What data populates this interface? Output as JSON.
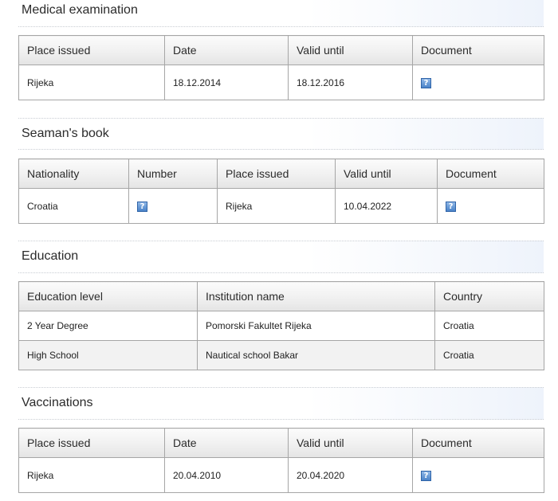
{
  "medical": {
    "title": "Medical examination",
    "headers": [
      "Place issued",
      "Date",
      "Valid until",
      "Document"
    ],
    "rows": [
      {
        "place": "Rijeka",
        "date": "18.12.2014",
        "valid": "18.12.2016",
        "doc_icon": "?"
      }
    ]
  },
  "seamans_book": {
    "title": "Seaman's book",
    "headers": [
      "Nationality",
      "Number",
      "Place issued",
      "Valid until",
      "Document"
    ],
    "rows": [
      {
        "nationality": "Croatia",
        "number_icon": "?",
        "place": "Rijeka",
        "valid": "10.04.2022",
        "doc_icon": "?"
      }
    ]
  },
  "education": {
    "title": "Education",
    "headers": [
      "Education level",
      "Institution name",
      "Country"
    ],
    "rows": [
      {
        "level": "2 Year Degree",
        "institution": "Pomorski Fakultet Rijeka",
        "country": "Croatia"
      },
      {
        "level": "High School",
        "institution": "Nautical school Bakar",
        "country": "Croatia"
      }
    ]
  },
  "vaccinations": {
    "title": "Vaccinations",
    "headers": [
      "Place issued",
      "Date",
      "Valid until",
      "Document"
    ],
    "rows": [
      {
        "place": "Rijeka",
        "date": "20.04.2010",
        "valid": "20.04.2020",
        "doc_icon": "?"
      }
    ]
  },
  "icons": {
    "document": "help-document-icon"
  },
  "colors": {
    "icon_blue": "#4a83c9",
    "header_bg": "#f0f0f0",
    "alt_row": "#f2f2f2"
  }
}
